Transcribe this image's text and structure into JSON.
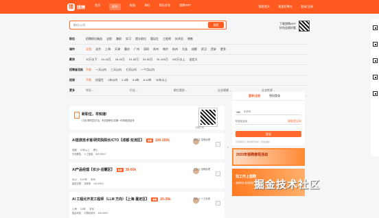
{
  "header": {
    "logo_mark": "猎",
    "logo_text": "猎聘",
    "nav": [
      "首页",
      "职位",
      "校园",
      "海归",
      "简历优化",
      "猎聘APP"
    ],
    "right": [
      "我是猎头",
      "我是招聘方",
      "登录/注册"
    ]
  },
  "search": {
    "placeholder": "职位/公司",
    "button": "搜索",
    "download_title": "下载猎聘APP",
    "download_desc": "好机会随时看"
  },
  "filters": [
    {
      "title": "职位",
      "options": [
        "招聘职位精选",
        "全职",
        "兼职",
        "实习",
        "猎头职位",
        "管培生",
        "工程师",
        "技术员",
        "销售"
      ],
      "active": 0
    },
    {
      "title": "城市",
      "options": [
        "全国",
        "北京",
        "上海",
        "天津",
        "重庆",
        "广州",
        "深圳",
        "苏州",
        "南京",
        "杭州",
        "大连",
        "成都",
        "武汉",
        "西安",
        "更多"
      ],
      "active": 0
    },
    {
      "title": "薪资",
      "options": [
        "10万以下",
        "10-15万",
        "16-20万",
        "21-30万",
        "31-50万",
        "51-100万",
        "100万以上",
        "自定义"
      ],
      "active": -1
    },
    {
      "title": "招聘者活跃",
      "options": [
        "不限",
        "一天以内",
        "三天以内",
        "七天以内",
        "一个月以内"
      ],
      "active": 0
    },
    {
      "title": "经验",
      "options": [
        "不限",
        "应届生",
        "1年以内",
        "1-3年",
        "3-5年",
        "5-10年",
        "10年以上"
      ],
      "active": 0
    }
  ],
  "more_filters": {
    "title": "更多",
    "selects": [
      "学历",
      "行业",
      "职位类别",
      "企业规模",
      "企业性质"
    ]
  },
  "notice": {
    "title": "新职位，早知道!",
    "desc": "订阅“求职意向”后，有匹配职位将第一时间推送给你",
    "qr_caption": "扫码订阅"
  },
  "jobs": [
    {
      "title": "AI首席技术官/研究院院长/CTO【成都·双流区】",
      "badge": "急聘",
      "salary": "100-150k",
      "meta": [
        "成都",
        "10年以上",
        "博士"
      ],
      "company": "华西数智",
      "industry": "人工智能",
      "size": "500-999人",
      "recruiter": "李先生 招聘经理"
    },
    {
      "title": "AI产品经理【长沙·岳麓区】",
      "badge": "急聘",
      "salary": "30-60k",
      "meta": [
        "长沙",
        "5-10年",
        "本科"
      ],
      "company": "星辰互联",
      "industry": "互联网",
      "size": "100-499人",
      "recruiter": "王女士 招聘经理"
    },
    {
      "title": "AI 工程化开发工程师（LLM 方向）【上海·嘉定区】",
      "badge": "急聘",
      "salary": "20-35k",
      "meta": [
        "上海",
        "3-5年",
        "本科"
      ],
      "company": "智启科技",
      "industry": "计算机软件",
      "size": "100-499人",
      "recruiter": "陈女士 人力资源"
    }
  ],
  "login": {
    "tabs": [
      "登录/注册",
      "密码登录"
    ],
    "phone_prefix": "+86",
    "phone_placeholder": "手机号",
    "code_placeholder": "短信验证码",
    "code_link": "获取验证码",
    "button": "登录",
    "agreement": "登录即同意《用户服务协议》《隐私政策》"
  },
  "banners": {
    "top": "2025年猎聘春招活动",
    "bottom_title": "找工作上猎聘",
    "bottom_sub": "海量职位 精准匹配"
  },
  "watermark": "掘金技术社区"
}
